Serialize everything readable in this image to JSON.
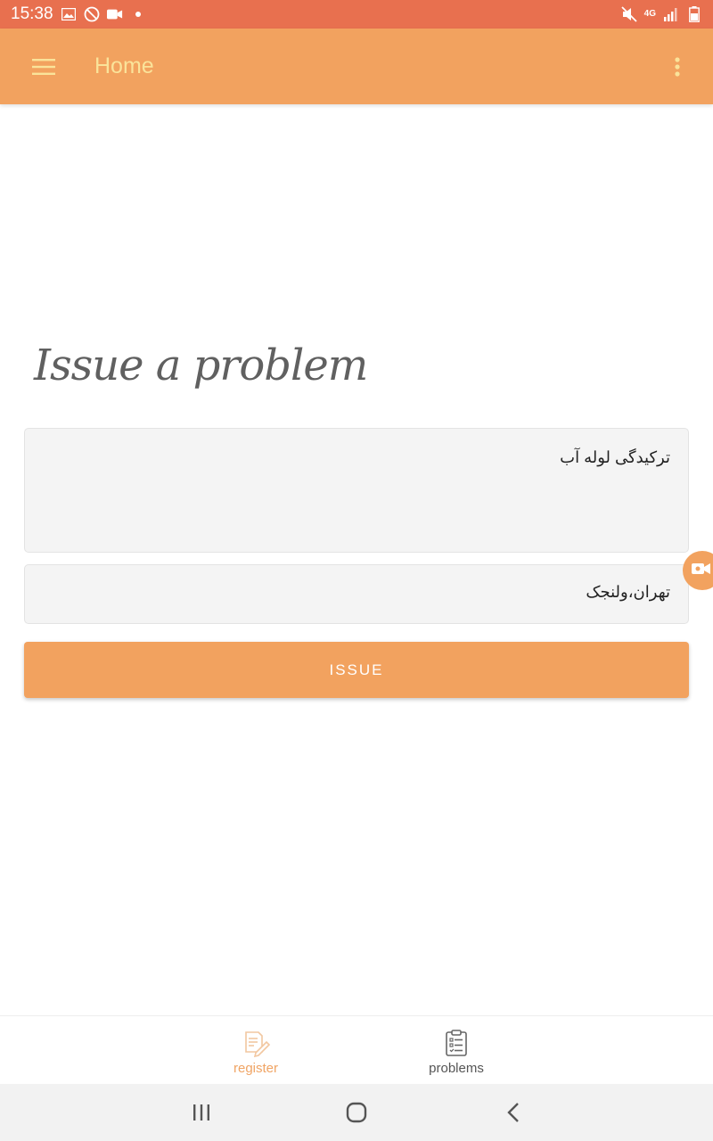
{
  "status_bar": {
    "time": "15:38",
    "network_label": "4G",
    "icons": [
      "image-icon",
      "blocked-icon",
      "video-record-icon",
      "dot-icon",
      "mute-icon",
      "signal-icon",
      "battery-icon"
    ]
  },
  "app_bar": {
    "title": "Home",
    "menu_icon": "hamburger-menu-icon",
    "overflow_icon": "more-vertical-icon"
  },
  "form": {
    "heading": "Issue a problem",
    "problem_value": "ترکیدگی لوله آب",
    "location_value": "تهران،ولنجک",
    "submit_label": "ISSUE"
  },
  "bottom_nav": {
    "items": [
      {
        "label": "register",
        "icon": "edit-document-icon",
        "active": true
      },
      {
        "label": "problems",
        "icon": "clipboard-list-icon",
        "active": false
      }
    ]
  },
  "colors": {
    "status_bar": "#e8704f",
    "app_bar": "#f2a25f",
    "title_text": "#fae39a",
    "accent": "#f0a464"
  }
}
